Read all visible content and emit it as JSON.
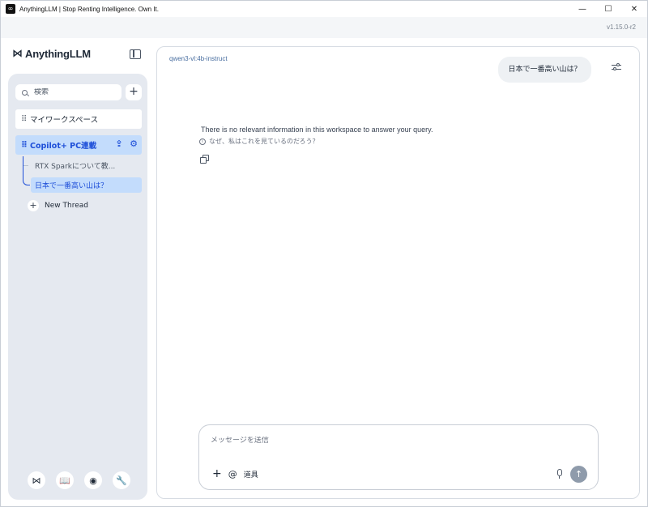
{
  "window": {
    "title": "AnythingLLM | Stop Renting Intelligence. Own It.",
    "controls": [
      "—",
      "☐",
      "✕"
    ],
    "version": "v1.15.0-r2"
  },
  "sidebar": {
    "brand": "AnythingLLM",
    "search_placeholder": "検索",
    "add_label": "+",
    "workspaces": [
      {
        "label": "マイワークスペース"
      },
      {
        "label": "Copilot+ PC連載",
        "active": true
      }
    ],
    "threads": [
      {
        "label": "RTX Sparkについて教..."
      },
      {
        "label": "日本で一番高い山は？",
        "active": true
      }
    ],
    "new_thread": "New Thread",
    "footer_icons": [
      "anythingllm-logo-icon",
      "docs-book-icon",
      "discord-icon",
      "settings-wrench-icon"
    ]
  },
  "chat": {
    "model": "qwen3-vl:4b-instruct",
    "user_message": "日本で一番高い山は？",
    "assistant_reply": "There is no relevant information in this workspace to answer your query.",
    "why_link": "なぜ、私はこれを見ているのだろう？"
  },
  "composer": {
    "placeholder": "メッセージを送信",
    "tools_label": "道具"
  },
  "colors": {
    "accent": "#1d4ed8",
    "active_bg": "#c3dcfc",
    "sidebar_bg": "#e5e9f0",
    "send_button": "#8f9bab"
  }
}
